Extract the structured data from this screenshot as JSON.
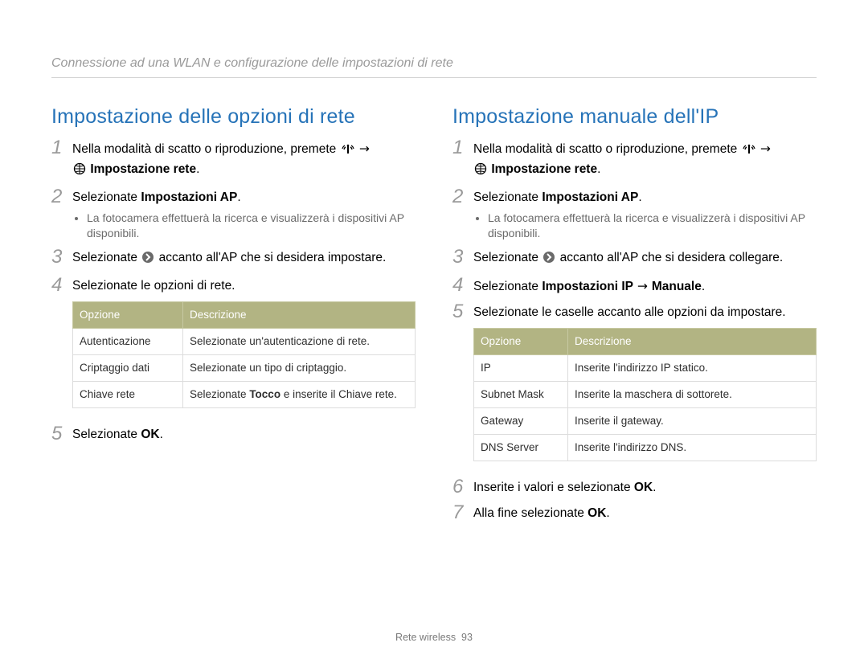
{
  "header": "Connessione ad una WLAN e configurazione delle impostazioni di rete",
  "footer": {
    "section": "Rete wireless",
    "page": "93"
  },
  "left": {
    "title": "Impostazione delle opzioni di rete",
    "step1_pre": "Nella modalità di scatto o riproduzione, premete ",
    "step1_post_arrow": " →",
    "step1_line2_bold": "Impostazione rete",
    "step2_text": "Selezionate ",
    "step2_bold": "Impostazioni AP",
    "step2_suffix": ".",
    "step2_bullet": "La fotocamera effettuerà la ricerca e visualizzerà i dispositivi AP disponibili.",
    "step3_pre": "Selezionate ",
    "step3_post": " accanto all'AP che si desidera impostare.",
    "step4": "Selezionate le opzioni di rete.",
    "table_h1": "Opzione",
    "table_h2": "Descrizione",
    "rows": [
      {
        "opt": "Autenticazione",
        "desc": "Selezionate un'autenticazione di rete."
      },
      {
        "opt": "Criptaggio dati",
        "desc": "Selezionate un tipo di criptaggio."
      },
      {
        "opt": "Chiave rete",
        "desc_pre": "Selezionate ",
        "desc_bold": "Tocco",
        "desc_post": " e inserite il Chiave rete."
      }
    ],
    "step5_pre": "Selezionate ",
    "step5_ok": "OK",
    "step5_post": "."
  },
  "right": {
    "title": "Impostazione manuale dell'IP",
    "step1_pre": "Nella modalità di scatto o riproduzione, premete ",
    "step1_post_arrow": " →",
    "step1_line2_bold": "Impostazione rete",
    "step2_text": "Selezionate ",
    "step2_bold": "Impostazioni AP",
    "step2_suffix": ".",
    "step2_bullet": "La fotocamera effettuerà la ricerca e visualizzerà i dispositivi AP disponibili.",
    "step3_pre": "Selezionate ",
    "step3_post": " accanto all'AP che si desidera collegare.",
    "step4_pre": "Selezionate ",
    "step4_bold": "Impostazioni IP",
    "step4_mid": " → ",
    "step4_bold2": "Manuale",
    "step4_post": ".",
    "step5": "Selezionate le caselle accanto alle opzioni da impostare.",
    "table_h1": "Opzione",
    "table_h2": "Descrizione",
    "rows": [
      {
        "opt": "IP",
        "desc": "Inserite l'indirizzo IP statico."
      },
      {
        "opt": "Subnet Mask",
        "desc": "Inserite la maschera di sottorete."
      },
      {
        "opt": "Gateway",
        "desc": "Inserite il gateway."
      },
      {
        "opt": "DNS Server",
        "desc": "Inserite l'indirizzo DNS."
      }
    ],
    "step6_pre": "Inserite i valori e selezionate ",
    "step6_ok": "OK",
    "step6_post": ".",
    "step7_pre": "Alla fine selezionate ",
    "step7_ok": "OK",
    "step7_post": "."
  }
}
